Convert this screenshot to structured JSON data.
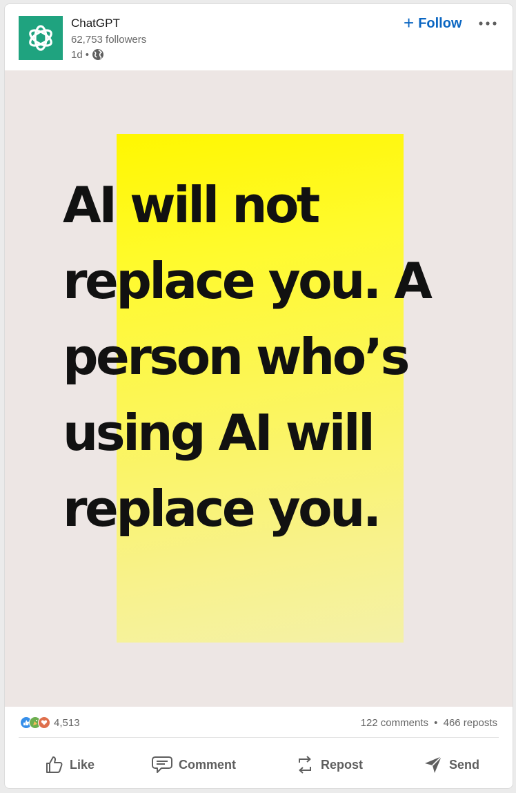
{
  "author": {
    "name": "ChatGPT",
    "followers": "62,753 followers",
    "time": "1d",
    "separator": "•",
    "logo_icon": "openai-logo-icon",
    "brand_color": "#1fa37f"
  },
  "header": {
    "follow_plus": "+",
    "follow_label": "Follow",
    "more_icon": "ellipsis-icon"
  },
  "post": {
    "image_lines": [
      "AI will not",
      "replace you. A",
      "person who’s",
      "using AI will",
      "replace you."
    ],
    "highlight_color": "#fff700"
  },
  "social": {
    "reaction_icons": [
      "like-reaction-icon",
      "celebrate-reaction-icon",
      "love-reaction-icon"
    ],
    "reaction_count": "4,513",
    "comments": "122 comments",
    "dot": "•",
    "reposts": "466 reposts"
  },
  "actions": {
    "like": "Like",
    "comment": "Comment",
    "repost": "Repost",
    "send": "Send"
  },
  "colors": {
    "link_blue": "#0a66c2",
    "muted_text": "#666666"
  }
}
